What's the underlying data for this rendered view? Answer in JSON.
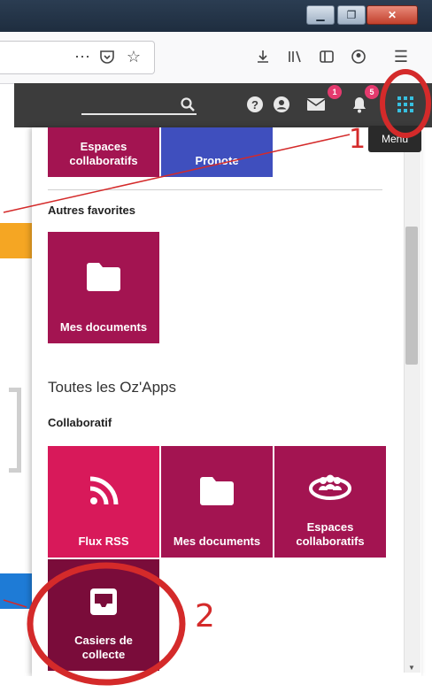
{
  "header": {
    "mail_badge": "1",
    "notif_badge": "5",
    "menu_tooltip": "Menu"
  },
  "panel": {
    "top_tiles": [
      {
        "label": "Espaces collaboratifs",
        "color": "#a31451"
      },
      {
        "label": "Pronote",
        "color": "#3f4fbe"
      }
    ],
    "favorites_title": "Autres favorites",
    "favorites": [
      {
        "label": "Mes documents",
        "icon": "folder-icon",
        "color": "#a31451"
      }
    ],
    "all_apps_title": "Toutes les Oz'Apps",
    "category_title": "Collaboratif",
    "apps": [
      {
        "label": "Flux RSS",
        "icon": "rss-icon",
        "color": "#d8195a"
      },
      {
        "label": "Mes documents",
        "icon": "folder-icon",
        "color": "#a31451"
      },
      {
        "label": "Espaces collaboratifs",
        "icon": "group-icon",
        "color": "#a31451"
      },
      {
        "label": "Casiers de collecte",
        "icon": "inbox-icon",
        "color": "#7a0c3a"
      }
    ]
  },
  "annotations": {
    "step1": "1",
    "step2": "2",
    "color": "#d42a2a"
  }
}
